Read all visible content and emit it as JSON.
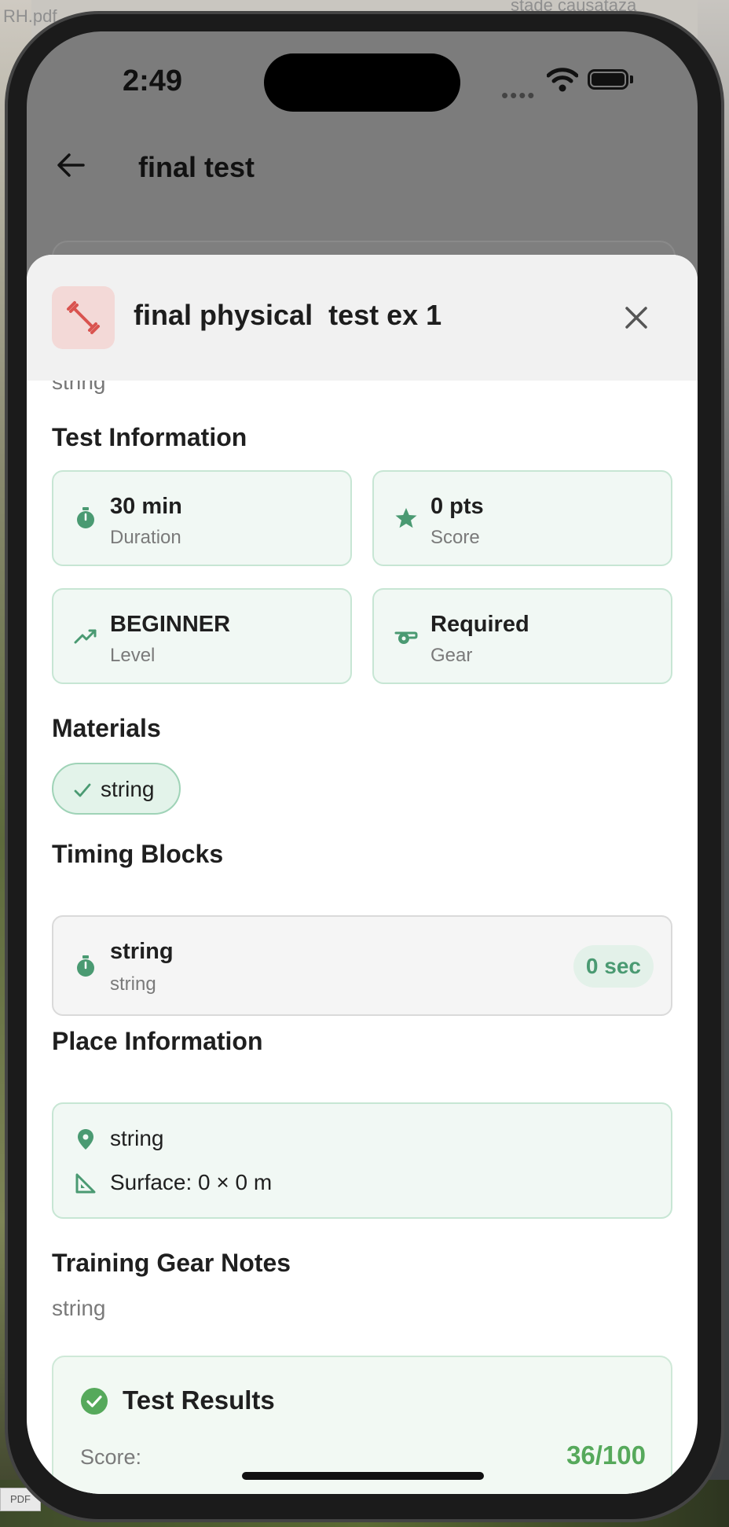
{
  "desktop": {
    "file_label": "RH.pdf",
    "right_label": "stade causataza",
    "pdf_tag": "PDF"
  },
  "status_bar": {
    "time": "2:49",
    "dots": "••••"
  },
  "nav": {
    "title": "final test"
  },
  "sheet": {
    "title": "final physical  test ex 1",
    "clipped_text": "string",
    "test_info": {
      "title": "Test Information",
      "cards": [
        {
          "value": "30 min",
          "label": "Duration",
          "icon": "stopwatch-icon"
        },
        {
          "value": "0 pts",
          "label": "Score",
          "icon": "star-icon"
        },
        {
          "value": "BEGINNER",
          "label": "Level",
          "icon": "trending-up-icon"
        },
        {
          "value": "Required",
          "label": "Gear",
          "icon": "whistle-icon"
        }
      ]
    },
    "materials": {
      "title": "Materials",
      "items": [
        "string"
      ]
    },
    "timing_blocks": {
      "title": "Timing Blocks",
      "items": [
        {
          "name": "string",
          "description": "string",
          "duration": "0 sec"
        }
      ]
    },
    "place": {
      "title": "Place Information",
      "location": "string",
      "surface": "Surface: 0 × 0 m"
    },
    "gear_notes": {
      "title": "Training Gear Notes",
      "text": "string"
    },
    "results": {
      "title": "Test Results",
      "score_label": "Score:",
      "score_value": "36/100"
    }
  },
  "colors": {
    "accent_green": "#4a9a72",
    "score_green": "#56a95b",
    "exercise_red": "#d9534f"
  }
}
